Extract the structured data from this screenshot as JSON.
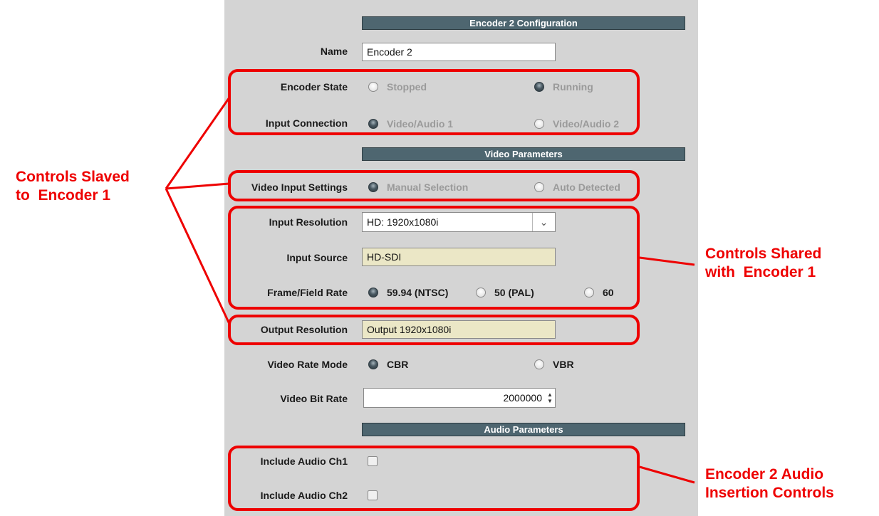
{
  "headers": {
    "encoder_config": "Encoder 2 Configuration",
    "video_params": "Video Parameters",
    "audio_params": "Audio Parameters"
  },
  "name": {
    "label": "Name",
    "value": "Encoder 2"
  },
  "encoder_state": {
    "label": "Encoder State",
    "opt1": "Stopped",
    "opt2": "Running",
    "selected": "Running"
  },
  "input_connection": {
    "label": "Input Connection",
    "opt1": "Video/Audio 1",
    "opt2": "Video/Audio 2",
    "selected": "Video/Audio 1"
  },
  "video_input_settings": {
    "label": "Video Input Settings",
    "opt1": "Manual Selection",
    "opt2": "Auto Detected",
    "selected": "Manual Selection"
  },
  "input_resolution": {
    "label": "Input Resolution",
    "value": "HD: 1920x1080i"
  },
  "input_source": {
    "label": "Input Source",
    "value": "HD-SDI"
  },
  "frame_rate": {
    "label": "Frame/Field Rate",
    "opt1": "59.94 (NTSC)",
    "opt2": "50 (PAL)",
    "opt3": "60",
    "selected": "59.94 (NTSC)"
  },
  "output_resolution": {
    "label": "Output Resolution",
    "value": "Output 1920x1080i"
  },
  "video_rate_mode": {
    "label": "Video Rate Mode",
    "opt1": "CBR",
    "opt2": "VBR",
    "selected": "CBR"
  },
  "video_bit_rate": {
    "label": "Video Bit Rate",
    "value": "2000000"
  },
  "audio_ch1": {
    "label": "Include Audio Ch1",
    "checked": false
  },
  "audio_ch2": {
    "label": "Include Audio Ch2",
    "checked": false
  },
  "callouts": {
    "slaved": "Controls Slaved\nto  Encoder 1",
    "shared": "Controls Shared\nwith  Encoder 1",
    "audio": "Encoder 2 Audio\nInsertion Controls"
  },
  "colors": {
    "callout": "#ee0000",
    "header_bg": "#4e6670",
    "panel_bg": "#d4d4d4",
    "readonly_field": "#ebe7c6"
  }
}
